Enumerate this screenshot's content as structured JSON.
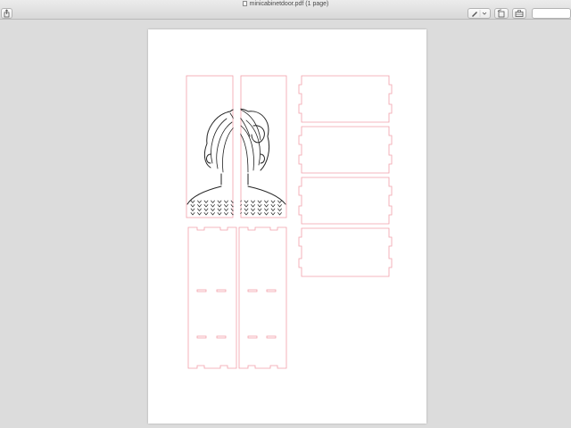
{
  "window": {
    "title": "minicabinetdoor.pdf (1 page)"
  },
  "toolbar": {
    "share_icon": "share-icon",
    "markup_icon": "pen-icon",
    "rotate_icon": "rotate-icon",
    "toolbox_icon": "toolbox-icon",
    "search_placeholder": ""
  },
  "colors": {
    "cut_line": "#f2a0aa",
    "engrave_line": "#222222",
    "page": "#ffffff",
    "desk": "#dcdcdc"
  }
}
